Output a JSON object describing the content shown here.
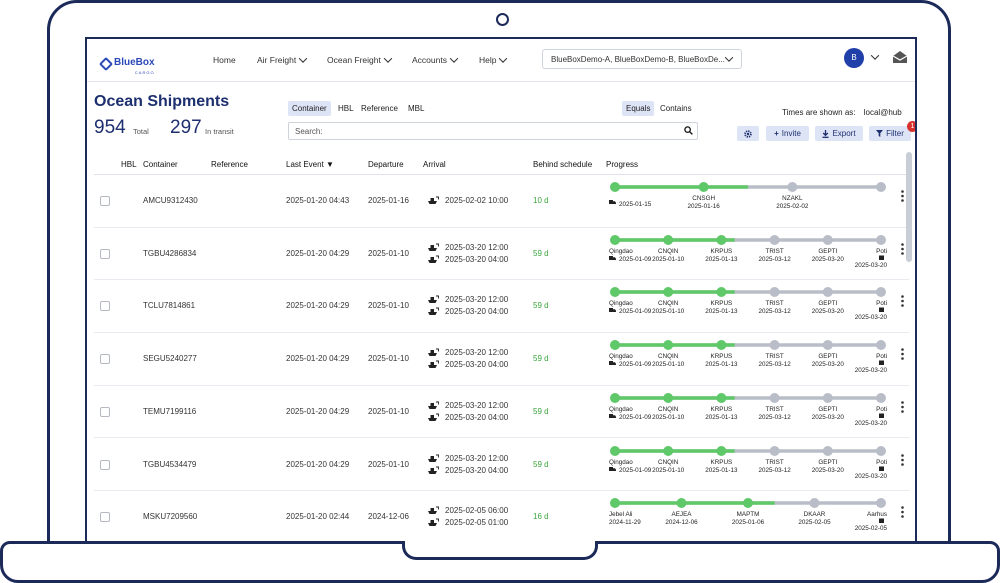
{
  "brand": {
    "name": "BlueBox",
    "sub": "CARGO"
  },
  "nav": [
    {
      "label": "Home",
      "has_menu": false
    },
    {
      "label": "Air Freight",
      "has_menu": true
    },
    {
      "label": "Ocean Freight",
      "has_menu": true
    },
    {
      "label": "Accounts",
      "has_menu": true
    },
    {
      "label": "Help",
      "has_menu": true
    }
  ],
  "tenant_selector": {
    "value": "BlueBoxDemo-A, BlueBoxDemo-B, BlueBoxDe..."
  },
  "user": {
    "initial": "B"
  },
  "page": {
    "title": "Ocean Shipments",
    "total_count": "954",
    "total_label": "Total",
    "transit_count": "297",
    "transit_label": "In transit"
  },
  "search_modes": {
    "types": [
      "Container",
      "HBL",
      "Reference",
      "MBL"
    ],
    "active_type": "Container",
    "match": [
      "Equals",
      "Contains"
    ],
    "active_match": "Equals",
    "search_placeholder": "Search:"
  },
  "timezone": {
    "label": "Times are shown as:",
    "value": "local@hub"
  },
  "toolbar": {
    "settings_icon": "gear-icon",
    "invite_label": "Invite",
    "export_label": "Export",
    "filter_label": "Filter",
    "filter_badge": "1"
  },
  "colors": {
    "brand": "#2b48b8",
    "navy": "#1d2f6f",
    "progress_done": "#5fc868",
    "progress_todo": "#b8bdc7",
    "late": "#39a43a",
    "badge": "#d8322f"
  },
  "columns": [
    "HBL",
    "Container",
    "Reference",
    "Last Event ▼",
    "Departure",
    "Arrival",
    "Behind schedule",
    "Progress"
  ],
  "rows": [
    {
      "container": "AMCU9312430",
      "reference": "",
      "last_event": "2025-01-20 04:43",
      "departure": "2025-01-16",
      "arrival": [
        "2025-02-02 10:00"
      ],
      "behind": "10  d",
      "progress": {
        "stops": [
          {
            "code": "",
            "date": "2025-01-15",
            "icon": "truck"
          },
          {
            "code": "CNSGH",
            "date": "2025-01-16"
          },
          {
            "code": "NZAKL",
            "date": "2025-02-02"
          },
          {
            "code": "",
            "date": ""
          }
        ],
        "done": 0.5
      }
    },
    {
      "container": "TGBU4286834",
      "reference": "",
      "last_event": "2025-01-20 04:29",
      "departure": "2025-01-10",
      "arrival": [
        "2025-03-20 12:00",
        "2025-03-20 04:00"
      ],
      "behind": "59  d",
      "progress": {
        "stops": [
          {
            "code": "Qingdao",
            "date": "2025-01-09",
            "icon": "truck"
          },
          {
            "code": "CNQIN",
            "date": "2025-01-10"
          },
          {
            "code": "KRPUS",
            "date": "2025-01-13"
          },
          {
            "code": "TRIST",
            "date": "2025-03-12"
          },
          {
            "code": "GEPTI",
            "date": "2025-03-20"
          },
          {
            "code": "Poti",
            "date": "2025-03-20",
            "icon": "box"
          }
        ],
        "done": 0.45
      }
    },
    {
      "container": "TCLU7814861",
      "reference": "",
      "last_event": "2025-01-20 04:29",
      "departure": "2025-01-10",
      "arrival": [
        "2025-03-20 12:00",
        "2025-03-20 04:00"
      ],
      "behind": "59  d",
      "progress": {
        "stops": [
          {
            "code": "Qingdao",
            "date": "2025-01-09",
            "icon": "truck"
          },
          {
            "code": "CNQIN",
            "date": "2025-01-10"
          },
          {
            "code": "KRPUS",
            "date": "2025-01-13"
          },
          {
            "code": "TRIST",
            "date": "2025-03-12"
          },
          {
            "code": "GEPTI",
            "date": "2025-03-20"
          },
          {
            "code": "Poti",
            "date": "2025-03-20",
            "icon": "box"
          }
        ],
        "done": 0.45
      }
    },
    {
      "container": "SEGU5240277",
      "reference": "",
      "last_event": "2025-01-20 04:29",
      "departure": "2025-01-10",
      "arrival": [
        "2025-03-20 12:00",
        "2025-03-20 04:00"
      ],
      "behind": "59  d",
      "progress": {
        "stops": [
          {
            "code": "Qingdao",
            "date": "2025-01-09",
            "icon": "truck"
          },
          {
            "code": "CNQIN",
            "date": "2025-01-10"
          },
          {
            "code": "KRPUS",
            "date": "2025-01-13"
          },
          {
            "code": "TRIST",
            "date": "2025-03-12"
          },
          {
            "code": "GEPTI",
            "date": "2025-03-20"
          },
          {
            "code": "Poti",
            "date": "2025-03-20",
            "icon": "box"
          }
        ],
        "done": 0.45
      }
    },
    {
      "container": "TEMU7199116",
      "reference": "",
      "last_event": "2025-01-20 04:29",
      "departure": "2025-01-10",
      "arrival": [
        "2025-03-20 12:00",
        "2025-03-20 04:00"
      ],
      "behind": "59  d",
      "progress": {
        "stops": [
          {
            "code": "Qingdao",
            "date": "2025-01-09",
            "icon": "truck"
          },
          {
            "code": "CNQIN",
            "date": "2025-01-10"
          },
          {
            "code": "KRPUS",
            "date": "2025-01-13"
          },
          {
            "code": "TRIST",
            "date": "2025-03-12"
          },
          {
            "code": "GEPTI",
            "date": "2025-03-20"
          },
          {
            "code": "Poti",
            "date": "2025-03-20",
            "icon": "box"
          }
        ],
        "done": 0.45
      }
    },
    {
      "container": "TGBU4534479",
      "reference": "",
      "last_event": "2025-01-20 04:29",
      "departure": "2025-01-10",
      "arrival": [
        "2025-03-20 12:00",
        "2025-03-20 04:00"
      ],
      "behind": "59  d",
      "progress": {
        "stops": [
          {
            "code": "Qingdao",
            "date": "2025-01-09",
            "icon": "truck"
          },
          {
            "code": "CNQIN",
            "date": "2025-01-10"
          },
          {
            "code": "KRPUS",
            "date": "2025-01-13"
          },
          {
            "code": "TRIST",
            "date": "2025-03-12"
          },
          {
            "code": "GEPTI",
            "date": "2025-03-20"
          },
          {
            "code": "Poti",
            "date": "2025-03-20",
            "icon": "box"
          }
        ],
        "done": 0.45
      }
    },
    {
      "container": "MSKU7209560",
      "reference": "",
      "last_event": "2025-01-20 02:44",
      "departure": "2024-12-06",
      "arrival": [
        "2025-02-05 06:00",
        "2025-02-05 01:00"
      ],
      "behind": "16  d",
      "progress": {
        "stops": [
          {
            "code": "Jebel Ali",
            "date": "2024-11-29"
          },
          {
            "code": "AEJEA",
            "date": "2024-12-06"
          },
          {
            "code": "MAPTM",
            "date": "2025-01-06"
          },
          {
            "code": "DKAAR",
            "date": "2025-02-05"
          },
          {
            "code": "Aarhus",
            "date": "2025-02-05",
            "icon": "box"
          }
        ],
        "done": 0.6
      }
    }
  ]
}
